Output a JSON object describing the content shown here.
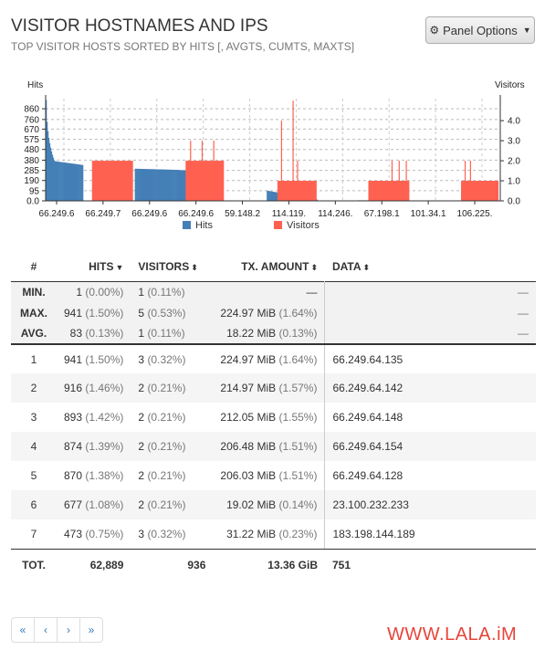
{
  "panel": {
    "title": "VISITOR HOSTNAMES AND IPS",
    "subtitle": "TOP VISITOR HOSTS SORTED BY HITS [, AVGTS, CUMTS, MAXTS]",
    "options_label": "Panel Options"
  },
  "chart_data": {
    "type": "bar",
    "left_axis_title": "Hits",
    "right_axis_title": "Visitors",
    "left_ticks": [
      "0.0",
      "95",
      "190",
      "285",
      "380",
      "480",
      "575",
      "670",
      "760",
      "860"
    ],
    "left_tick_values": [
      0,
      95,
      190,
      285,
      380,
      480,
      575,
      670,
      760,
      860
    ],
    "left_max": 955,
    "right_ticks": [
      "0.0",
      "1.0",
      "2.0",
      "3.0",
      "4.0"
    ],
    "right_tick_values": [
      0,
      1,
      2,
      3,
      4
    ],
    "right_max": 5.1,
    "x_labels": [
      "66.249.6",
      "66.249.7",
      "66.249.6",
      "66.249.6",
      "59.148.2",
      "114.119.",
      "114.246.",
      "67.198.1",
      "101.34.1",
      "106.225."
    ],
    "legend": [
      {
        "name": "Hits",
        "color": "#447fb6"
      },
      {
        "name": "Visitors",
        "color": "#ff6150"
      }
    ],
    "hits_segments": [
      {
        "start": 0,
        "end": 10,
        "from": 941,
        "to": 380
      },
      {
        "start": 10,
        "end": 42,
        "from": 370,
        "to": 335
      },
      {
        "start": 100,
        "end": 145,
        "from": 300,
        "to": 290
      },
      {
        "start": 145,
        "end": 190,
        "from": 290,
        "to": 268
      },
      {
        "start": 248,
        "end": 300,
        "from": 95,
        "to": 20
      },
      {
        "start": 300,
        "end": 305,
        "from": 15,
        "to": 12
      },
      {
        "start": 350,
        "end": 405,
        "from": 5,
        "to": 4
      }
    ],
    "visitor_blocks": [
      {
        "start": 52,
        "end": 98,
        "value": 2
      },
      {
        "start": 157,
        "end": 200,
        "value": 2
      },
      {
        "start": 260,
        "end": 304,
        "value": 1
      },
      {
        "start": 362,
        "end": 408,
        "value": 1
      },
      {
        "start": 466,
        "end": 508,
        "value": 1
      }
    ],
    "visitor_spikes": [
      {
        "pos": 162,
        "value": 3
      },
      {
        "pos": 168,
        "value": 2
      },
      {
        "pos": 175,
        "value": 3
      },
      {
        "pos": 181,
        "value": 2
      },
      {
        "pos": 188,
        "value": 3
      },
      {
        "pos": 194,
        "value": 2
      },
      {
        "pos": 264,
        "value": 4
      },
      {
        "pos": 277,
        "value": 5
      },
      {
        "pos": 282,
        "value": 2
      },
      {
        "pos": 388,
        "value": 2
      },
      {
        "pos": 396,
        "value": 2
      },
      {
        "pos": 404,
        "value": 2
      },
      {
        "pos": 470,
        "value": 2
      },
      {
        "pos": 476,
        "value": 2
      }
    ],
    "bar_count": 510
  },
  "table": {
    "headers": {
      "num": "#",
      "hits": "HITS",
      "visitors": "VISITORS",
      "tx": "TX. AMOUNT",
      "data": "DATA"
    },
    "summary": [
      {
        "label": "MIN.",
        "hits": "1",
        "hits_pct": "(0.00%)",
        "visitors": "1",
        "visitors_pct": "(0.11%)",
        "tx": "—",
        "tx_pct": "",
        "data": "—"
      },
      {
        "label": "MAX.",
        "hits": "941",
        "hits_pct": "(1.50%)",
        "visitors": "5",
        "visitors_pct": "(0.53%)",
        "tx": "224.97 MiB",
        "tx_pct": "(1.64%)",
        "data": "—"
      },
      {
        "label": "AVG.",
        "hits": "83",
        "hits_pct": "(0.13%)",
        "visitors": "1",
        "visitors_pct": "(0.11%)",
        "tx": "18.22 MiB",
        "tx_pct": "(0.13%)",
        "data": "—"
      }
    ],
    "rows": [
      {
        "num": "1",
        "hits": "941",
        "hits_pct": "(1.50%)",
        "visitors": "3",
        "visitors_pct": "(0.32%)",
        "tx": "224.97 MiB",
        "tx_pct": "(1.64%)",
        "data": "66.249.64.135"
      },
      {
        "num": "2",
        "hits": "916",
        "hits_pct": "(1.46%)",
        "visitors": "2",
        "visitors_pct": "(0.21%)",
        "tx": "214.97 MiB",
        "tx_pct": "(1.57%)",
        "data": "66.249.64.142"
      },
      {
        "num": "3",
        "hits": "893",
        "hits_pct": "(1.42%)",
        "visitors": "2",
        "visitors_pct": "(0.21%)",
        "tx": "212.05 MiB",
        "tx_pct": "(1.55%)",
        "data": "66.249.64.148"
      },
      {
        "num": "4",
        "hits": "874",
        "hits_pct": "(1.39%)",
        "visitors": "2",
        "visitors_pct": "(0.21%)",
        "tx": "206.48 MiB",
        "tx_pct": "(1.51%)",
        "data": "66.249.64.154"
      },
      {
        "num": "5",
        "hits": "870",
        "hits_pct": "(1.38%)",
        "visitors": "2",
        "visitors_pct": "(0.21%)",
        "tx": "206.03 MiB",
        "tx_pct": "(1.51%)",
        "data": "66.249.64.128"
      },
      {
        "num": "6",
        "hits": "677",
        "hits_pct": "(1.08%)",
        "visitors": "2",
        "visitors_pct": "(0.21%)",
        "tx": "19.02 MiB",
        "tx_pct": "(0.14%)",
        "data": "23.100.232.233"
      },
      {
        "num": "7",
        "hits": "473",
        "hits_pct": "(0.75%)",
        "visitors": "3",
        "visitors_pct": "(0.32%)",
        "tx": "31.22 MiB",
        "tx_pct": "(0.23%)",
        "data": "183.198.144.189"
      }
    ],
    "total": {
      "label": "TOT.",
      "hits": "62,889",
      "visitors": "936",
      "tx": "13.36 GiB",
      "data": "751"
    }
  },
  "pagination": {
    "first": "«",
    "prev": "‹",
    "next": "›",
    "last": "»"
  },
  "watermark": "WWW.LALA.iM"
}
